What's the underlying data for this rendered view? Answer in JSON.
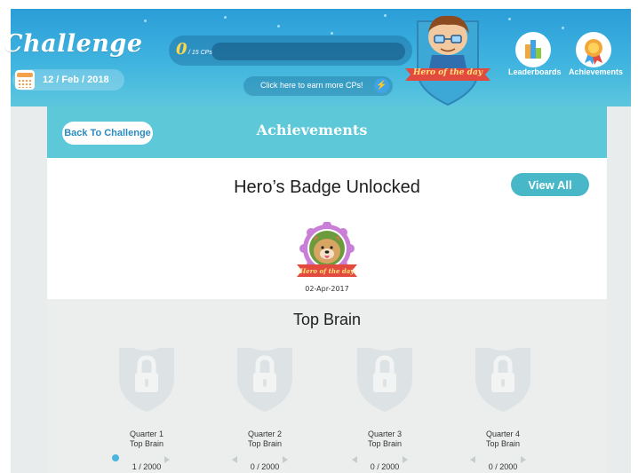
{
  "header": {
    "logo": "Challenge",
    "date": "12 / Feb / 2018",
    "cp_value": "0",
    "cp_total": "/ 15 CPs",
    "earn_link": "Click here to earn more CPs!",
    "hero_banner": "Hero of the day",
    "nav": [
      {
        "label": "Leaderboards",
        "icon": "leaderboard-icon"
      },
      {
        "label": "Achievements",
        "icon": "achievement-medal-icon"
      }
    ]
  },
  "achievements": {
    "back_label": "Back To Challenge",
    "title": "Achievements"
  },
  "badge": {
    "title": "Hero’s Badge Unlocked",
    "view_all": "View All",
    "medal_banner": "Hero of the day",
    "date": "02-Apr-2017"
  },
  "top_brain": {
    "title": "Top Brain",
    "quarters": [
      {
        "name": "Quarter 1",
        "sub": "Top Brain",
        "progress": "1 / 2000",
        "progress_value": 1,
        "progress_max": 2000
      },
      {
        "name": "Quarter 2",
        "sub": "Top Brain",
        "progress": "0 / 2000",
        "progress_value": 0,
        "progress_max": 2000
      },
      {
        "name": "Quarter 3",
        "sub": "Top Brain",
        "progress": "0 / 2000",
        "progress_value": 0,
        "progress_max": 2000
      },
      {
        "name": "Quarter 4",
        "sub": "Top Brain",
        "progress": "0 / 2000",
        "progress_value": 0,
        "progress_max": 2000
      }
    ]
  },
  "colors": {
    "header_blue": "#2b9dd8",
    "band_teal": "#5cc8d8",
    "button_teal": "#48b8c8",
    "cp_yellow": "#ffd84a",
    "locked_grey": "#dde3e4"
  }
}
